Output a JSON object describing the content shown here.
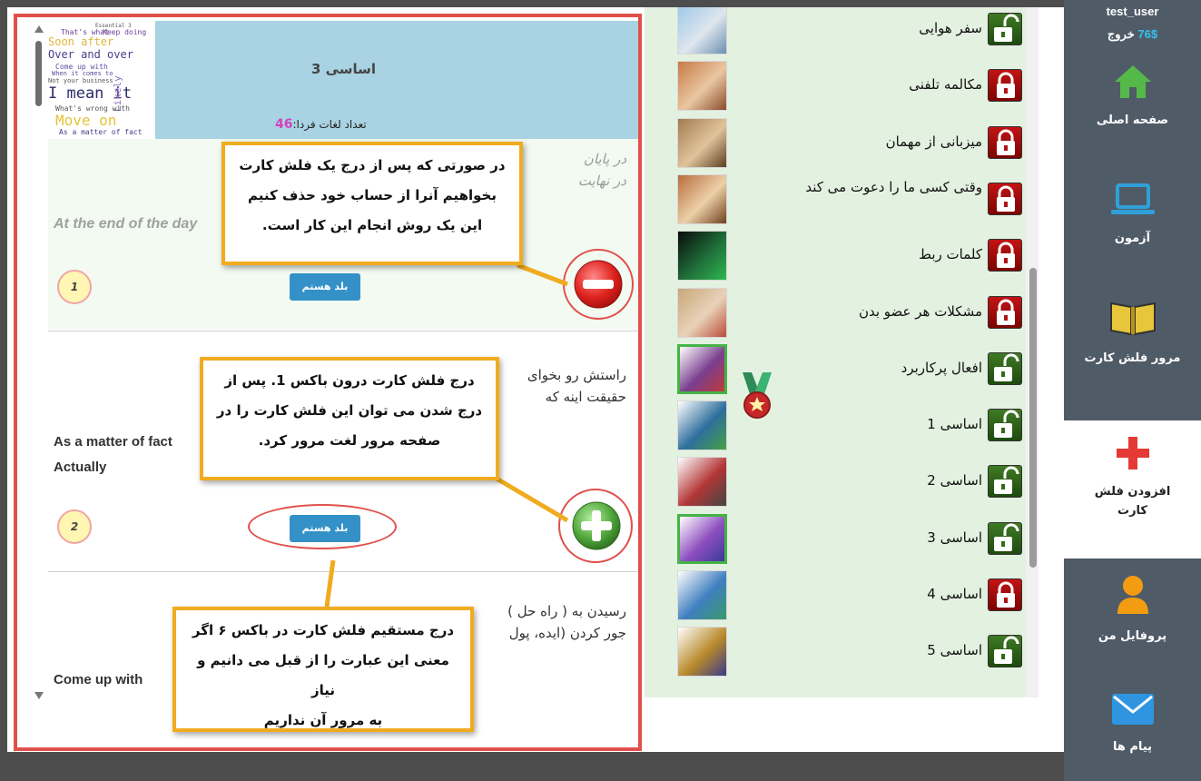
{
  "sidebar": {
    "username": "test_user",
    "credit": "76$",
    "logout": "خروج",
    "items": [
      {
        "label": "صفحه اصلی",
        "icon": "home-icon"
      },
      {
        "label": "آزمون",
        "icon": "laptop-icon"
      },
      {
        "label": "مرور فلش کارت",
        "icon": "book-icon"
      },
      {
        "label": "افزودن فلش کارت",
        "icon": "plus-icon",
        "active": true
      },
      {
        "label": "پروفایل من",
        "icon": "user-icon"
      },
      {
        "label": "پیام ها",
        "icon": "mail-icon"
      }
    ]
  },
  "lessons": [
    {
      "title": "سفر هوایی",
      "locked": false,
      "status": "open"
    },
    {
      "title": "مکالمه تلفنی",
      "locked": true
    },
    {
      "title": "میزبانی از مهمان",
      "locked": true
    },
    {
      "title": "وقتی کسی ما را دعوت می کند",
      "locked": true
    },
    {
      "title": "کلمات ربط",
      "locked": true
    },
    {
      "title": "مشکلات هر عضو بدن",
      "locked": true
    },
    {
      "title": "افعال پرکاربرد",
      "locked": false,
      "completed": true
    },
    {
      "title": "اساسی 1",
      "locked": false
    },
    {
      "title": "اساسی 2",
      "locked": false
    },
    {
      "title": "اساسی 3",
      "locked": false,
      "completed": true
    },
    {
      "title": "اساسی 4",
      "locked": true
    },
    {
      "title": "اساسی 5",
      "locked": false
    }
  ],
  "card_panel": {
    "title": "اساسی 3",
    "tomorrow_label": "تعداد لغات فردا:",
    "tomorrow_count": "46",
    "wordcloud": [
      "Essential 3",
      "That's what",
      "Keep doing",
      "Soon after",
      "Over and over",
      "Come up with",
      "When it comes to",
      "Not your business",
      "I mean it",
      "Likely",
      "What's wrong with",
      "Move on",
      "As a matter of fact"
    ],
    "cards": [
      {
        "meaning": [
          "در پایان",
          "در نهایت"
        ],
        "phrase": [
          "At the end of the day"
        ],
        "box": "1",
        "know_button": "بلد هستم",
        "action": "remove"
      },
      {
        "meaning": [
          "راستش رو بخوای",
          "حقیقت اینه که"
        ],
        "phrase": [
          "As a matter of fact",
          "Actually"
        ],
        "box": "2",
        "know_button": "بلد هستم",
        "action": "add"
      },
      {
        "meaning": [
          "رسیدن به ( راه حل )",
          "جور کردن (ایده، پول"
        ],
        "phrase": [
          "Come up with"
        ]
      }
    ]
  },
  "callouts": {
    "remove": [
      "در صورتی که پس از درج یک فلش کارت",
      "بخواهیم آنرا از حساب خود حذف کنیم",
      "این یک روش انجام این کار است."
    ],
    "add": [
      "درج  فلش کارت درون باکس 1. پس از",
      "درج شدن می توان این فلش کارت را در",
      "صفحه مرور لغت مرور کرد."
    ],
    "know": [
      "درج مستقیم فلش کارت در باکس ۶ اگر",
      "معنی این عبارت را از قبل می دانیم و نیاز",
      "به مرور آن نداریم"
    ]
  },
  "colors": {
    "callout_border": "#f0ac1f",
    "highlight": "#e0504b",
    "sidebar": "#505b68",
    "lesson_bg": "#e3f1e1",
    "know_button": "#3491c7"
  }
}
